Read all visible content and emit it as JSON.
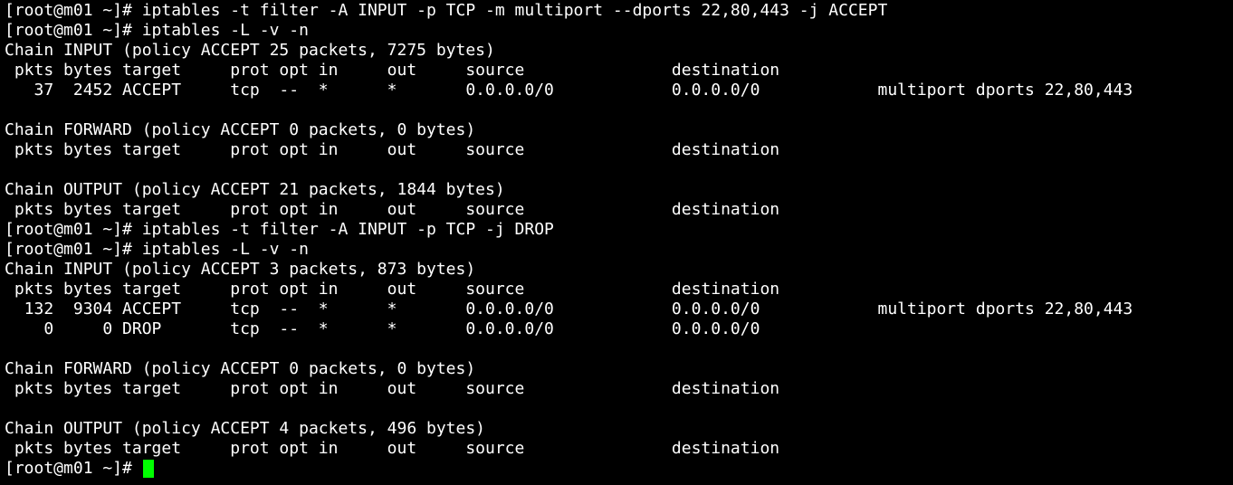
{
  "terminal": {
    "prompt": "[root@m01 ~]# ",
    "cursor_color": "#00ff00",
    "text_color": "#ffffff",
    "background_color": "#000000",
    "lines": [
      "[root@m01 ~]# iptables -t filter -A INPUT -p TCP -m multiport --dports 22,80,443 -j ACCEPT",
      "[root@m01 ~]# iptables -L -v -n",
      "Chain INPUT (policy ACCEPT 25 packets, 7275 bytes)",
      " pkts bytes target     prot opt in     out     source               destination",
      "   37  2452 ACCEPT     tcp  --  *      *       0.0.0.0/0            0.0.0.0/0            multiport dports 22,80,443",
      "",
      "Chain FORWARD (policy ACCEPT 0 packets, 0 bytes)",
      " pkts bytes target     prot opt in     out     source               destination",
      "",
      "Chain OUTPUT (policy ACCEPT 21 packets, 1844 bytes)",
      " pkts bytes target     prot opt in     out     source               destination",
      "[root@m01 ~]# iptables -t filter -A INPUT -p TCP -j DROP",
      "[root@m01 ~]# iptables -L -v -n",
      "Chain INPUT (policy ACCEPT 3 packets, 873 bytes)",
      " pkts bytes target     prot opt in     out     source               destination",
      "  132  9304 ACCEPT     tcp  --  *      *       0.0.0.0/0            0.0.0.0/0            multiport dports 22,80,443",
      "    0     0 DROP       tcp  --  *      *       0.0.0.0/0            0.0.0.0/0",
      "",
      "Chain FORWARD (policy ACCEPT 0 packets, 0 bytes)",
      " pkts bytes target     prot opt in     out     source               destination",
      "",
      "Chain OUTPUT (policy ACCEPT 4 packets, 496 bytes)",
      " pkts bytes target     prot opt in     out     source               destination"
    ]
  }
}
